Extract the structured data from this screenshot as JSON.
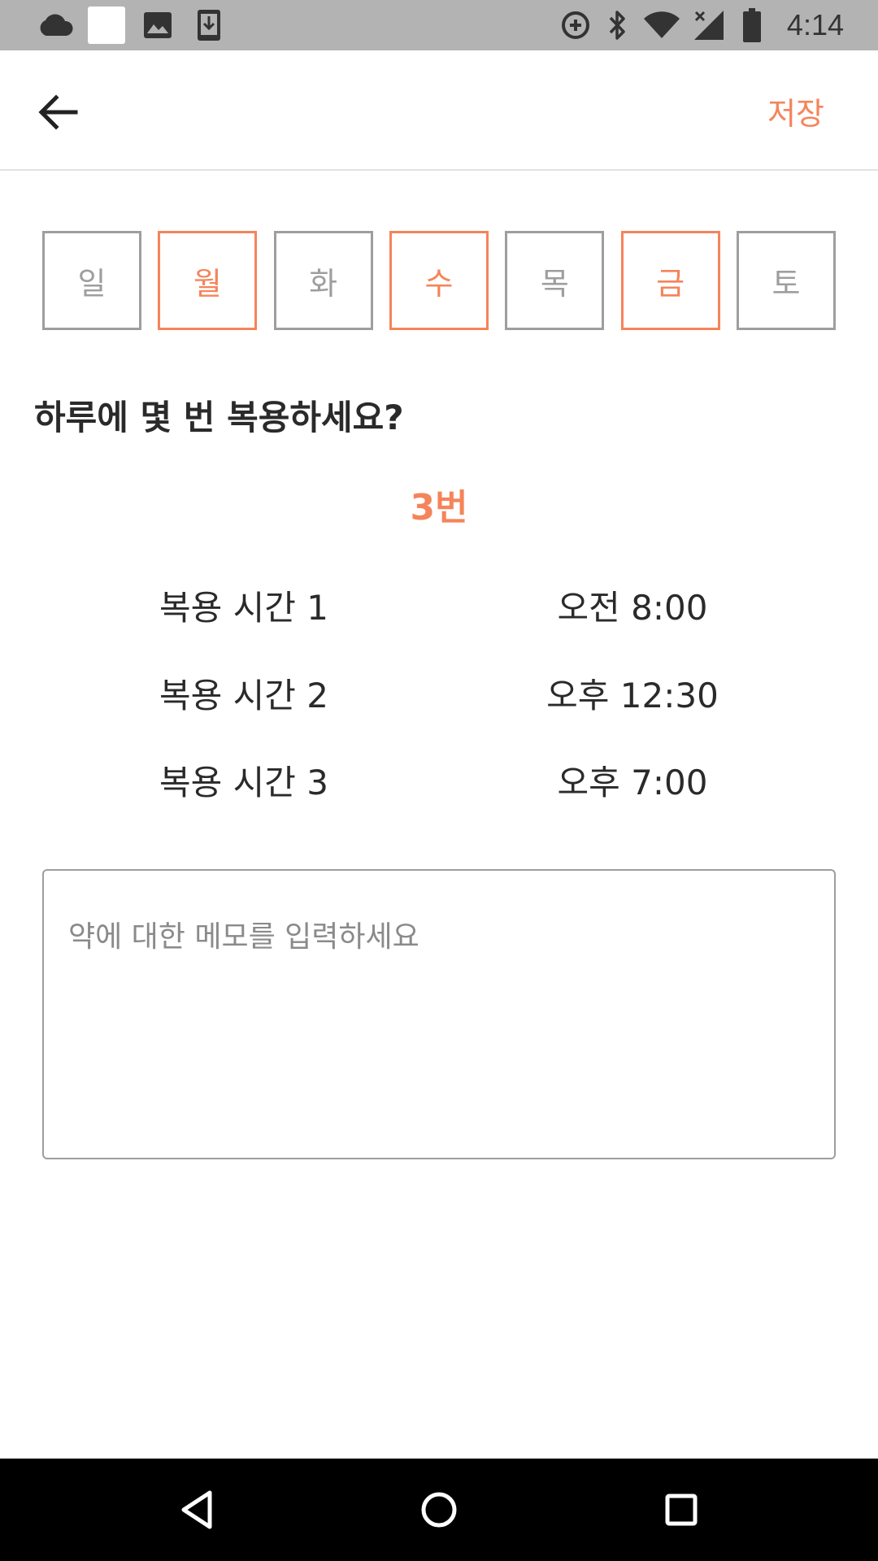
{
  "status_bar": {
    "time": "4:14",
    "left_icons": [
      "cloud-icon",
      "blank-square-icon",
      "image-icon",
      "download-icon"
    ],
    "right_icons": [
      "data-saver-icon",
      "bluetooth-icon",
      "wifi-icon",
      "signal-icon",
      "battery-icon"
    ]
  },
  "app_bar": {
    "back_icon": "arrow-left-icon",
    "save_label": "저장"
  },
  "days": [
    {
      "label": "일",
      "selected": false
    },
    {
      "label": "월",
      "selected": true
    },
    {
      "label": "화",
      "selected": false
    },
    {
      "label": "수",
      "selected": true
    },
    {
      "label": "목",
      "selected": false
    },
    {
      "label": "금",
      "selected": true
    },
    {
      "label": "토",
      "selected": false
    }
  ],
  "question": "하루에 몇 번 복용하세요?",
  "count_label": "3번",
  "times": [
    {
      "label": "복용 시간 1",
      "value": "오전 8:00"
    },
    {
      "label": "복용 시간 2",
      "value": "오후 12:30"
    },
    {
      "label": "복용 시간 3",
      "value": "오후 7:00"
    }
  ],
  "memo": {
    "placeholder": "약에 대한 메모를 입력하세요",
    "value": ""
  },
  "nav_bar": {
    "icons": [
      "back-triangle-icon",
      "home-circle-icon",
      "recents-square-icon"
    ]
  },
  "colors": {
    "accent": "#f5845a",
    "unselected_border": "#9e9e9e",
    "status_bar_bg": "#b3b3b3",
    "nav_bar_bg": "#000000"
  }
}
